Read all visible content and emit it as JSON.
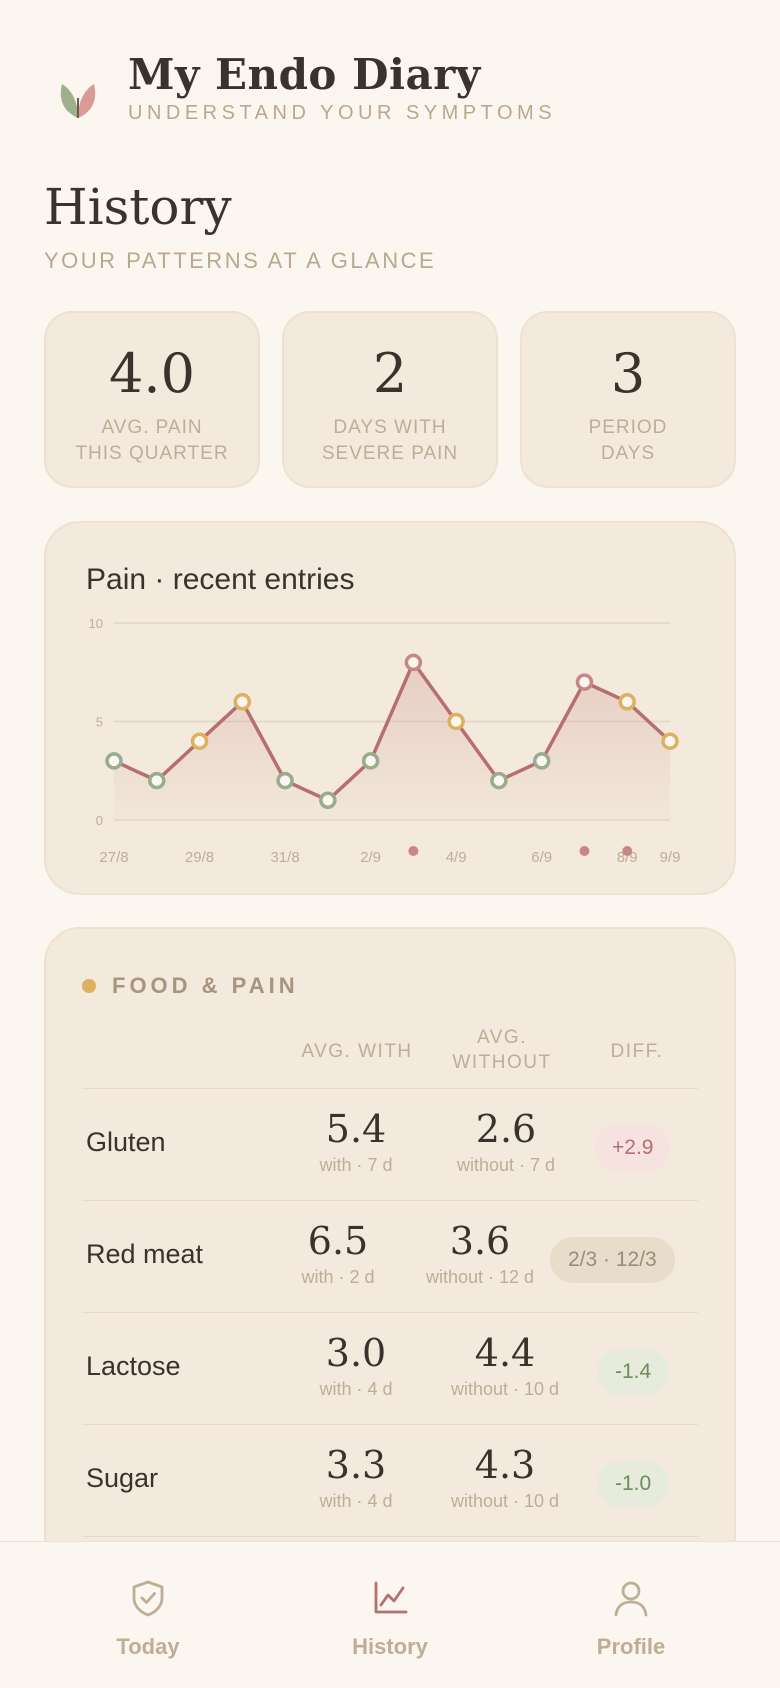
{
  "app": {
    "title": "My Endo Diary",
    "subtitle": "UNDERSTAND YOUR SYMPTOMS"
  },
  "page": {
    "title": "History",
    "subtitle": "YOUR PATTERNS AT A GLANCE"
  },
  "stats": [
    {
      "value": "4.0",
      "label": "AVG. PAIN\nTHIS QUARTER"
    },
    {
      "value": "2",
      "label": "DAYS WITH\nSEVERE PAIN"
    },
    {
      "value": "3",
      "label": "PERIOD\nDAYS"
    }
  ],
  "chart_data": {
    "type": "line",
    "title": "Pain · recent entries",
    "xlabel": "",
    "ylabel": "",
    "ylim": [
      0,
      10
    ],
    "y_ticks": [
      "0",
      "5",
      "10"
    ],
    "x_tick_labels": [
      "27/8",
      "29/8",
      "31/8",
      "2/9",
      "4/9",
      "6/9",
      "8/9",
      "9/9"
    ],
    "x_tick_index": [
      0,
      2,
      4,
      6,
      8,
      10,
      12,
      13
    ],
    "series": [
      {
        "values": [
          3,
          2,
          4,
          6,
          2,
          1,
          3,
          8,
          5,
          2,
          3,
          7,
          6,
          4
        ]
      }
    ],
    "period_marker_index": [
      7,
      11,
      12
    ],
    "grid": true,
    "colors": {
      "line": "#b76e6e",
      "low": "#97ad8b",
      "mid": "#dcb15f",
      "high": "#c98686",
      "period_marker": "#c98686"
    }
  },
  "food": {
    "heading": "FOOD & PAIN",
    "columns": {
      "with": "AVG. WITH",
      "without": "AVG.\nWITHOUT",
      "diff": "DIFF."
    },
    "rows": [
      {
        "name": "Gluten",
        "with_val": "5.4",
        "with_sub": "with · 7 d",
        "without_val": "2.6",
        "without_sub": "without · 7 d",
        "diff": "+2.9",
        "diff_type": "up"
      },
      {
        "name": "Red meat",
        "with_val": "6.5",
        "with_sub": "with · 2 d",
        "without_val": "3.6",
        "without_sub": "without · 12 d",
        "diff": "2/3 · 12/3",
        "diff_type": "neutral"
      },
      {
        "name": "Lactose",
        "with_val": "3.0",
        "with_sub": "with · 4 d",
        "without_val": "4.4",
        "without_sub": "without · 10 d",
        "diff": "-1.4",
        "diff_type": "down"
      },
      {
        "name": "Sugar",
        "with_val": "3.3",
        "with_sub": "with · 4 d",
        "without_val": "4.3",
        "without_sub": "without · 10 d",
        "diff": "-1.0",
        "diff_type": "down"
      }
    ],
    "badge_colors": {
      "up": {
        "bg": "#f6e3df",
        "fg": "#b76e6e"
      },
      "neutral": {
        "bg": "#e8dccb",
        "fg": "#9c8c78"
      },
      "down": {
        "bg": "#e7ebdc",
        "fg": "#6f8a5e"
      }
    }
  },
  "nav": {
    "items": [
      {
        "label": "Today",
        "icon": "shield-check-icon"
      },
      {
        "label": "History",
        "icon": "chart-line-icon"
      },
      {
        "label": "Profile",
        "icon": "user-icon"
      }
    ],
    "active": "History"
  }
}
